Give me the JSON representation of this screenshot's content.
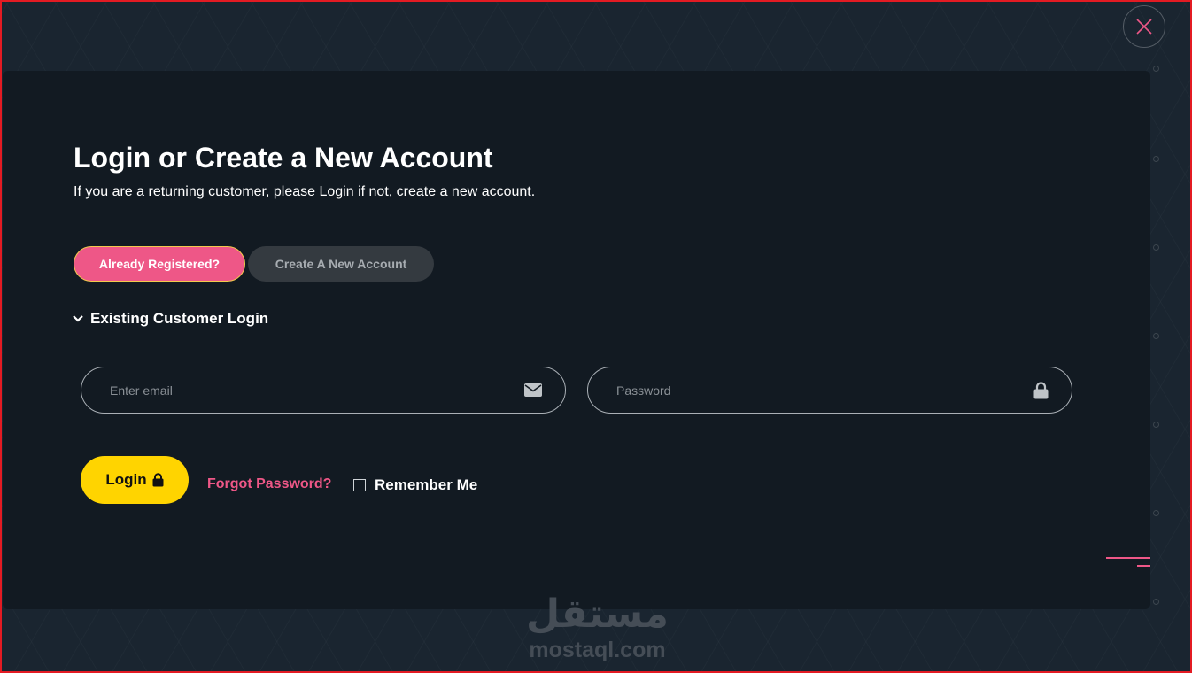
{
  "modal": {
    "title": "Login or Create a New Account",
    "subtitle": "If you are a returning customer, please Login if not, create a new account.",
    "close_icon": "close-icon"
  },
  "tabs": [
    {
      "label": "Already Registered?",
      "active": true
    },
    {
      "label": "Create A New Account",
      "active": false
    }
  ],
  "section": {
    "label": "Existing Customer Login",
    "icon": "chevron-down-icon"
  },
  "email_field": {
    "placeholder": "Enter email",
    "value": "",
    "icon": "envelope-icon"
  },
  "password_field": {
    "placeholder": "Password",
    "value": "",
    "icon": "lock-icon"
  },
  "actions": {
    "login_label": "Login",
    "login_icon": "lock-icon",
    "forgot_label": "Forgot Password?",
    "remember_label": "Remember Me",
    "remember_checked": false
  },
  "watermark": {
    "arabic": "مستقل",
    "latin": "mostaql.com"
  },
  "colors": {
    "background": "#1a2530",
    "modal": "#121a22",
    "accent_pink": "#ee5787",
    "accent_yellow": "#ffd400",
    "tab_inactive": "#343a40",
    "border_red": "#e31b23"
  }
}
